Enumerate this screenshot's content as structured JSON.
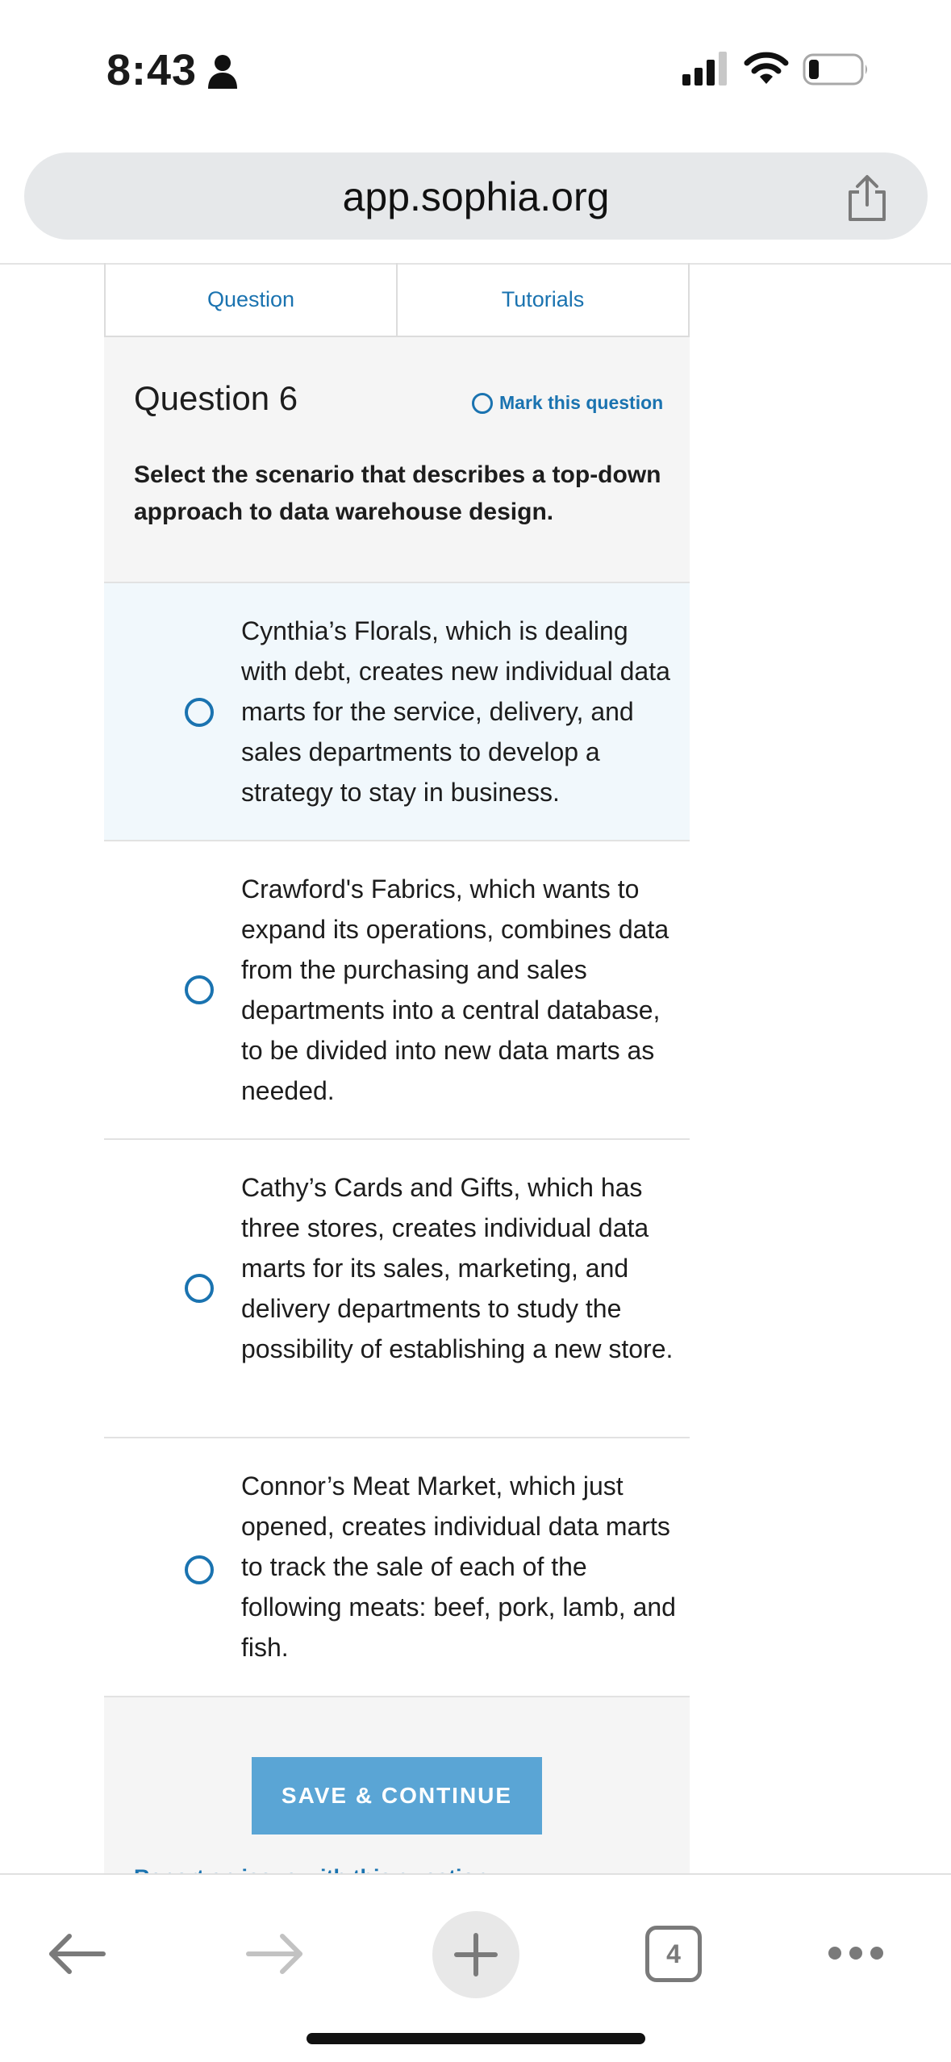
{
  "status_bar": {
    "time": "8:43"
  },
  "browser": {
    "url": "app.sophia.org",
    "tab_count": "4"
  },
  "tabs": [
    {
      "label": "Question"
    },
    {
      "label": "Tutorials"
    }
  ],
  "question": {
    "title": "Question 6",
    "mark_label": "Mark this question",
    "text": "Select the scenario that describes a top-down approach to data warehouse design."
  },
  "options": [
    {
      "text": "Cynthia’s Florals, which is dealing with debt, creates new individual data marts for the service, delivery, and sales departments to develop a strategy to stay in business."
    },
    {
      "text": "Crawford's Fabrics, which wants to expand its operations, combines data from the purchasing and sales departments into a central database, to be divided into new data marts as needed."
    },
    {
      "text": "Cathy’s Cards and Gifts, which has three stores, creates individual data marts for its sales, marketing, and delivery departments to study the possibility of establishing a new store."
    },
    {
      "text": "Connor’s Meat Market, which just opened, creates individual data marts to track the sale of each of the following meats: beef, pork, lamb, and fish."
    }
  ],
  "footer": {
    "save_label": "SAVE & CONTINUE",
    "report_label": "Report an issue with this question"
  },
  "colors": {
    "accent": "#1a73b0",
    "button": "#5aa5d5",
    "highlight": "#f1f8fc"
  }
}
